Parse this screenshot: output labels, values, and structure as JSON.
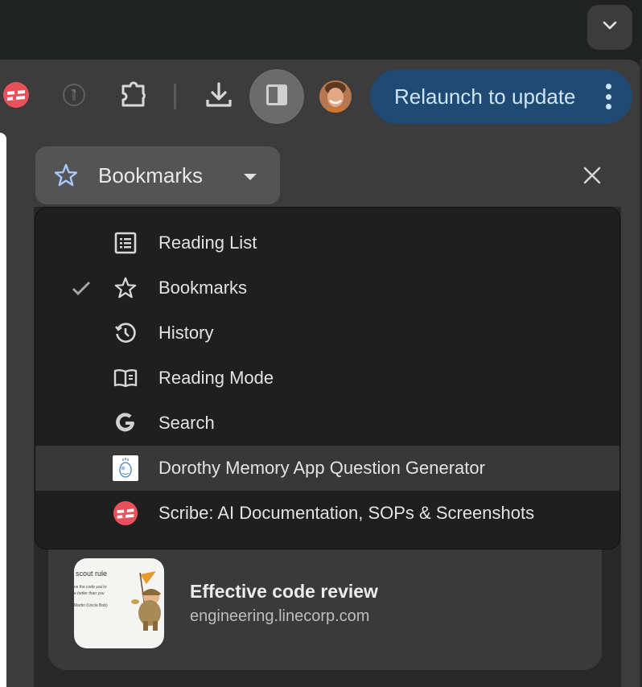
{
  "titlebar": {
    "tab_search_icon": "chevron-down-icon"
  },
  "toolbar": {
    "extensions": [
      {
        "name": "Scribe",
        "icon": "scribe-icon",
        "color": "#e8505b"
      },
      {
        "name": "1Password",
        "icon": "1password-icon"
      },
      {
        "name": "Extensions",
        "icon": "puzzle-icon"
      }
    ],
    "downloads_icon": "download-icon",
    "side_panel_icon": "side-panel-icon",
    "profile_avatar": "avatar",
    "relaunch_label": "Relaunch to update",
    "menu_icon": "more-vert-icon",
    "relaunch_color": "#1f4a73"
  },
  "side_panel": {
    "selector_label": "Bookmarks",
    "selector_icon": "star-icon",
    "selector_icon_color": "#a8c7fa",
    "close_icon": "close-icon",
    "menu": {
      "items": [
        {
          "label": "Reading List",
          "icon": "reading-list-icon",
          "checked": false
        },
        {
          "label": "Bookmarks",
          "icon": "star-icon",
          "checked": true
        },
        {
          "label": "History",
          "icon": "history-icon",
          "checked": false
        },
        {
          "label": "Reading Mode",
          "icon": "reading-mode-icon",
          "checked": false
        },
        {
          "label": "Search",
          "icon": "google-icon",
          "checked": false
        },
        {
          "label": "Dorothy Memory App Question Generator",
          "icon": "dorothy-icon",
          "checked": false,
          "hovered": true
        },
        {
          "label": "Scribe: AI Documentation, SOPs & Screenshots",
          "icon": "scribe-icon",
          "checked": false
        }
      ]
    },
    "bookmark_card": {
      "title": "Effective code review",
      "url": "engineering.linecorp.com",
      "thumbnail_text": {
        "heading": "scout rule",
        "quote_line1": "ve the code you're",
        "quote_line2": "e better than you",
        "author": "Martin (Uncle Bob)"
      }
    }
  }
}
